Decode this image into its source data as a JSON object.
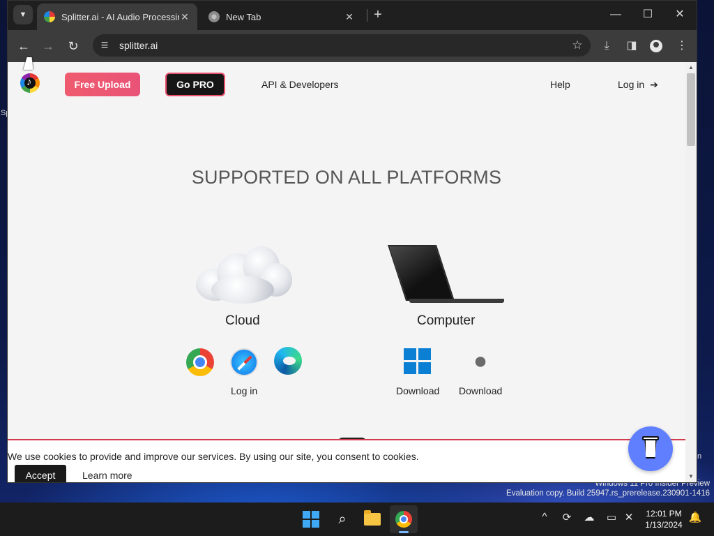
{
  "window": {
    "tabs": [
      {
        "title": "Splitter.ai - AI Audio Processing",
        "active": true
      },
      {
        "title": "New Tab",
        "active": false
      }
    ],
    "tab_search_icon": "chevron-down-icon",
    "new_tab_label": "+",
    "controls": {
      "minimize": "—",
      "maximize": "☐",
      "close": "✕"
    }
  },
  "toolbar": {
    "back": "←",
    "forward": "→",
    "reload": "↻",
    "url": "splitter.ai",
    "star": "☆",
    "download": "⤓",
    "sidepanel": "◨",
    "menu": "⋮"
  },
  "site": {
    "nav": {
      "free_upload": "Free Upload",
      "go_pro": "Go PRO",
      "api": "API & Developers",
      "help": "Help",
      "login": "Log in",
      "login_icon": "➔"
    },
    "headline": "SUPPORTED ON ALL PLATFORMS",
    "platforms": {
      "cloud": {
        "label": "Cloud",
        "action": "Log in"
      },
      "computer": {
        "label": "Computer",
        "windows_action": "Download",
        "mac_action": "Download"
      }
    },
    "cookie": {
      "text": "We use cookies to provide and improve our services. By using our site, you consent to cookies.",
      "accept": "Accept",
      "learn_more": "Learn more"
    }
  },
  "desktop": {
    "ghost_left": "Sp",
    "ghost_right": "n",
    "watermark_line1": "Windows 11 Pro Insider Preview",
    "watermark_line2": "Evaluation copy. Build 25947.rs_prerelease.230901-1416"
  },
  "taskbar": {
    "tray": {
      "chevron": "^",
      "time": "12:01 PM",
      "date": "1/13/2024"
    }
  },
  "colors": {
    "accent_pink": "#e95377",
    "windows_blue": "#0a7fd4",
    "coffee_button": "#5f7fff"
  }
}
